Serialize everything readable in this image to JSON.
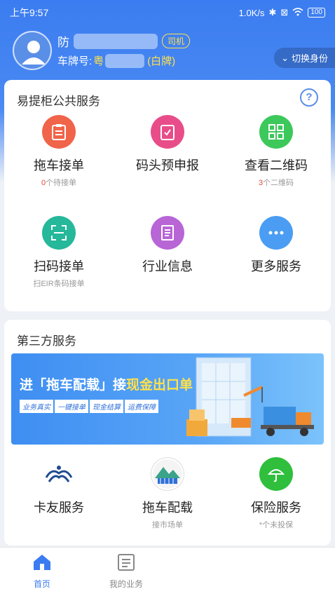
{
  "status": {
    "time": "上午9:57",
    "speed": "1.0K/s",
    "battery": "100"
  },
  "profile": {
    "name_prefix": "防",
    "role": "司机",
    "plate_label": "车牌号:",
    "plate_prefix": "粤",
    "plate_type": "(白牌)",
    "switch_label": "切换身份"
  },
  "public_services": {
    "title": "易提柜公共服务",
    "help": "?",
    "items": [
      {
        "label": "拖车接单",
        "count": "0",
        "sub": "个待接单",
        "color": "#f0644a",
        "icon": "clipboard-icon"
      },
      {
        "label": "码头预申报",
        "sub": "",
        "color": "#e84d8a",
        "icon": "checklist-icon"
      },
      {
        "label": "查看二维码",
        "count": "3",
        "sub": "个二维码",
        "color": "#3cc85a",
        "icon": "qrcode-icon"
      },
      {
        "label": "扫码接单",
        "sub": "扫EIR条码接单",
        "color": "#25b89a",
        "icon": "scan-icon"
      },
      {
        "label": "行业信息",
        "sub": "",
        "color": "#b865d6",
        "icon": "document-icon"
      },
      {
        "label": "更多服务",
        "sub": "",
        "color": "#4a9df2",
        "icon": "more-icon"
      }
    ]
  },
  "third_party": {
    "title": "第三方服务",
    "banner": {
      "prefix": "进",
      "quoted": "「拖车配载」",
      "mid": "接",
      "highlight": "现金出口单",
      "tags": [
        "业务真实",
        "一键接单",
        "现金结算",
        "运费保障"
      ]
    },
    "items": [
      {
        "label": "卡友服务",
        "sub": "",
        "icon": "wave-logo-icon"
      },
      {
        "label": "拖车配载",
        "sub": "接市场单",
        "icon": "mountain-logo-icon"
      },
      {
        "label": "保险服务",
        "sub": "*个未投保",
        "icon": "umbrella-icon"
      }
    ]
  },
  "tabs": [
    {
      "label": "首页",
      "icon": "home-icon",
      "active": true
    },
    {
      "label": "我的业务",
      "icon": "list-icon",
      "active": false
    }
  ],
  "colors": {
    "accent": "#3b7cf0",
    "highlight": "#ffe14a"
  }
}
